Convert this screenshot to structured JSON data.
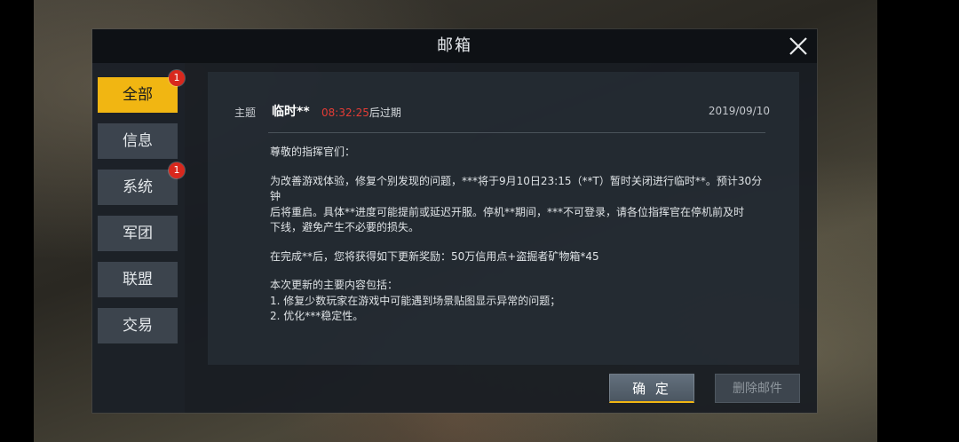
{
  "window": {
    "title": "邮箱"
  },
  "sidebar": {
    "tabs": [
      {
        "label": "全部",
        "badge": "1",
        "active": true
      },
      {
        "label": "信息",
        "badge": ""
      },
      {
        "label": "系统",
        "badge": "1"
      },
      {
        "label": "军团",
        "badge": ""
      },
      {
        "label": "联盟",
        "badge": ""
      },
      {
        "label": "交易",
        "badge": ""
      }
    ]
  },
  "mail": {
    "subject_label": "主题",
    "subject": "临时**",
    "timer": "08:32:25",
    "expire_suffix": "后过期",
    "date": "2019/09/10",
    "greeting": "尊敬的指挥官们：",
    "para1": [
      "为改善游戏体验，修复个别发现的问题，***将于9月10日23:15（**T）暂时关闭进行临时**。预计30分钟",
      "后将重启。具体**进度可能提前或延迟开服。停机**期间，***不可登录，请各位指挥官在停机前及时",
      "下线，避免产生不必要的损失。"
    ],
    "para2": "在完成**后，您将获得如下更新奖励：50万信用点+盗掘者矿物箱*45",
    "para3": [
      "本次更新的主要内容包括：",
      "1. 修复少数玩家在游戏中可能遇到场景贴图显示异常的问题；",
      "2. 优化***稳定性。"
    ]
  },
  "buttons": {
    "confirm": "确 定",
    "delete": "删除邮件"
  },
  "icons": {
    "close": "close-icon"
  },
  "colors": {
    "accent": "#f1b612",
    "badge": "#d8281d",
    "timer": "#e43c35"
  }
}
